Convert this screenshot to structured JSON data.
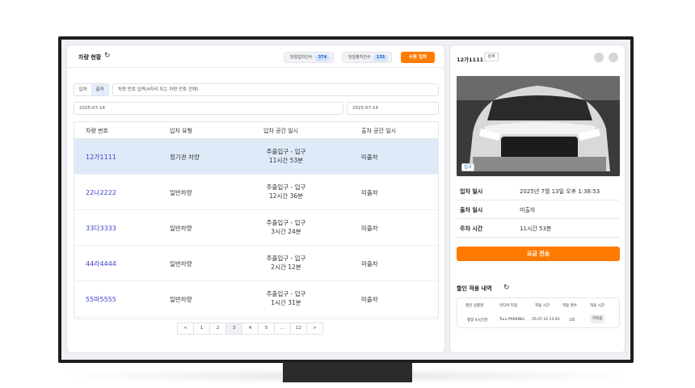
{
  "header": {
    "title": "차량 현황",
    "today_entry_label": "당일입차건수",
    "today_entry_count": "374",
    "today_exit_label": "당일출차건수",
    "today_exit_count": "135",
    "manual_entry_label": "수동 입차"
  },
  "filters": {
    "entry_tab": "입차",
    "exit_tab": "출차",
    "search_placeholder": "차량 번호 입력(4자리 또는 차량 번호 전체)",
    "date_from": "2025-07-14",
    "date_to": "2025-07-14"
  },
  "table": {
    "columns": [
      "차량 번호",
      "입차 유형",
      "입차 공간 일시",
      "출차 공간 일시"
    ],
    "rows": [
      {
        "plate": "12가1111",
        "type": "정기권 차량",
        "entry_line1": "주출입구 - 입구",
        "entry_line2": "11시간 53분",
        "exit": "미출차"
      },
      {
        "plate": "22나2222",
        "type": "일반차량",
        "entry_line1": "주출입구 - 입구",
        "entry_line2": "12시간 36분",
        "exit": "미출차"
      },
      {
        "plate": "33다3333",
        "type": "일반차량",
        "entry_line1": "주출입구 - 입구",
        "entry_line2": "3시간 24분",
        "exit": "미출차"
      },
      {
        "plate": "44라4444",
        "type": "일반차량",
        "entry_line1": "주출입구 - 입구",
        "entry_line2": "2시간 12분",
        "exit": "미출차"
      },
      {
        "plate": "55마5555",
        "type": "일반차량",
        "entry_line1": "주출입구 - 입구",
        "entry_line2": "1시간 31분",
        "exit": "미출차"
      }
    ]
  },
  "pagination": {
    "prev": "<",
    "pages": [
      "1",
      "2",
      "3",
      "4",
      "5",
      "...",
      "12"
    ],
    "current": "3",
    "next": ">"
  },
  "detail": {
    "plate": "12가1111",
    "detail_label": "상세",
    "photo_tag": "입구",
    "entry_time_label": "입차 일시",
    "entry_time_value": "2025년 7월 13일 오후 1:38:53",
    "exit_time_label": "출차 일시",
    "exit_time_value": "미출차",
    "parking_time_label": "주차 시간",
    "parking_time_value": "11시간 53분",
    "send_fee_label": "요금 전송",
    "discount_title": "할인 적용 내역",
    "discount_columns": [
      "할인 상품명",
      "미디어 타입",
      "적용 시간",
      "적용 횟수",
      "적용 시간"
    ],
    "discount_row": [
      "평일 4시간권",
      "Turu PARKING",
      "25.07.14 13:45",
      "1회",
      "미적용"
    ]
  },
  "colors": {
    "accent_orange": "#ff7a00",
    "selected_row": "#dfeaf9",
    "plate_blue": "#3b3fc9"
  }
}
